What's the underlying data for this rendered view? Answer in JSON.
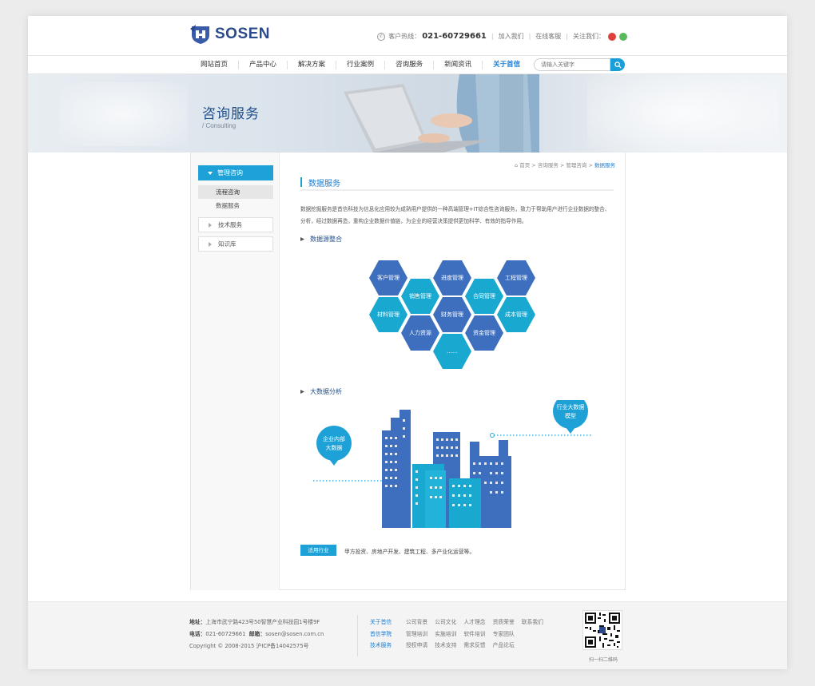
{
  "header": {
    "logo_text": "SOSEN",
    "hotline_label": "客户热线：",
    "hotline_number": "021-60729661",
    "join_us": "加入我们",
    "online_service": "在线客服",
    "follow_us": "关注我们："
  },
  "nav": {
    "items": [
      "网站首页",
      "产品中心",
      "解决方案",
      "行业案例",
      "咨询服务",
      "新闻资讯",
      "关于首信"
    ],
    "search_placeholder": "请输入关键字"
  },
  "banner": {
    "title": "咨询服务",
    "subtitle": "/ Consulting"
  },
  "sidebar": {
    "active_group": "管理咨询",
    "sub_items": [
      "流程咨询",
      "数据服务"
    ],
    "groups": [
      "技术服务",
      "知识库"
    ]
  },
  "breadcrumb": {
    "home": "首页",
    "level1": "咨询服务",
    "level2": "管理咨询",
    "current": "数据服务"
  },
  "main": {
    "title": "数据服务",
    "intro_line1": "数据挖掘服务是首信科技为信息化应用较为成熟用户提供的一种高端管理+IT综合性咨询服务，致力于帮助用户进行企业数据的整合、",
    "intro_line2": "分析，经过数据再造，重构企业数据价值链，为企业的经营决策提供更加科学、有效的指导作用。",
    "section1": "数据源整合",
    "hexagons": [
      "客户管理",
      "进度管理",
      "工程管理",
      "销售管理",
      "合同管理",
      "材料管理",
      "财务管理",
      "成本管理",
      "人力资源",
      "资金管理",
      "……"
    ],
    "section2": "大数据分析",
    "bubble_left": [
      "企业内部",
      "大数据"
    ],
    "bubble_right": [
      "行业大数据",
      "模型"
    ],
    "industry_label": "适用行业",
    "industry_text": "甲方投资、房地产开发、建筑工程、多产业化运营等。"
  },
  "footer": {
    "address_label": "地址：",
    "address": "上海市武宁路423号50智慧产业科技园1号楼9F",
    "phone_label": "电话：",
    "phone": "021-60729661",
    "email_label": "邮箱：",
    "email": "sosen@sosen.com.cn",
    "copyright": "Copyright © 2008-2015 沪ICP备14042575号",
    "link_rows": [
      {
        "head": "关于首信",
        "links": [
          "公司背景",
          "公司文化",
          "人才理念",
          "资质荣誉",
          "联系我们"
        ]
      },
      {
        "head": "首信学院",
        "links": [
          "管理培训",
          "实施培训",
          "软件培训",
          "专家团队"
        ]
      },
      {
        "head": "技术服务",
        "links": [
          "授权申请",
          "技术支持",
          "需求反馈",
          "产品论坛"
        ]
      }
    ],
    "qr_caption": "扫一扫二维码"
  },
  "colors": {
    "accent": "#1ea1d6",
    "brand": "#2b4a8c",
    "hex_dark": "#3e6fbf",
    "hex_light": "#18a8d0"
  }
}
